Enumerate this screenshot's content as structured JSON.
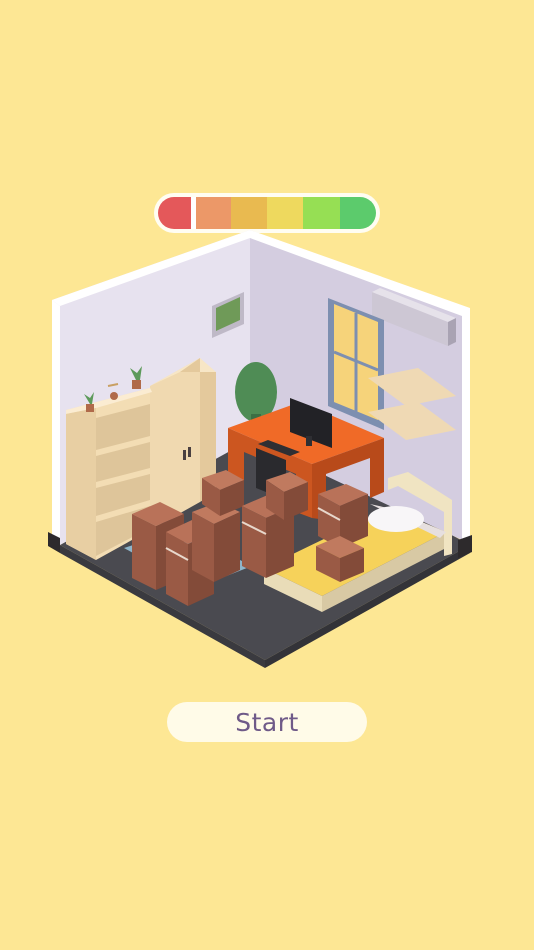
{
  "meter": {
    "segment_colors": [
      "#e4585a",
      "#ec9868",
      "#e9ba50",
      "#eed95e",
      "#96df54",
      "#5ccb6c"
    ],
    "indicator_level": 0.16
  },
  "start_button": {
    "label": "Start"
  }
}
